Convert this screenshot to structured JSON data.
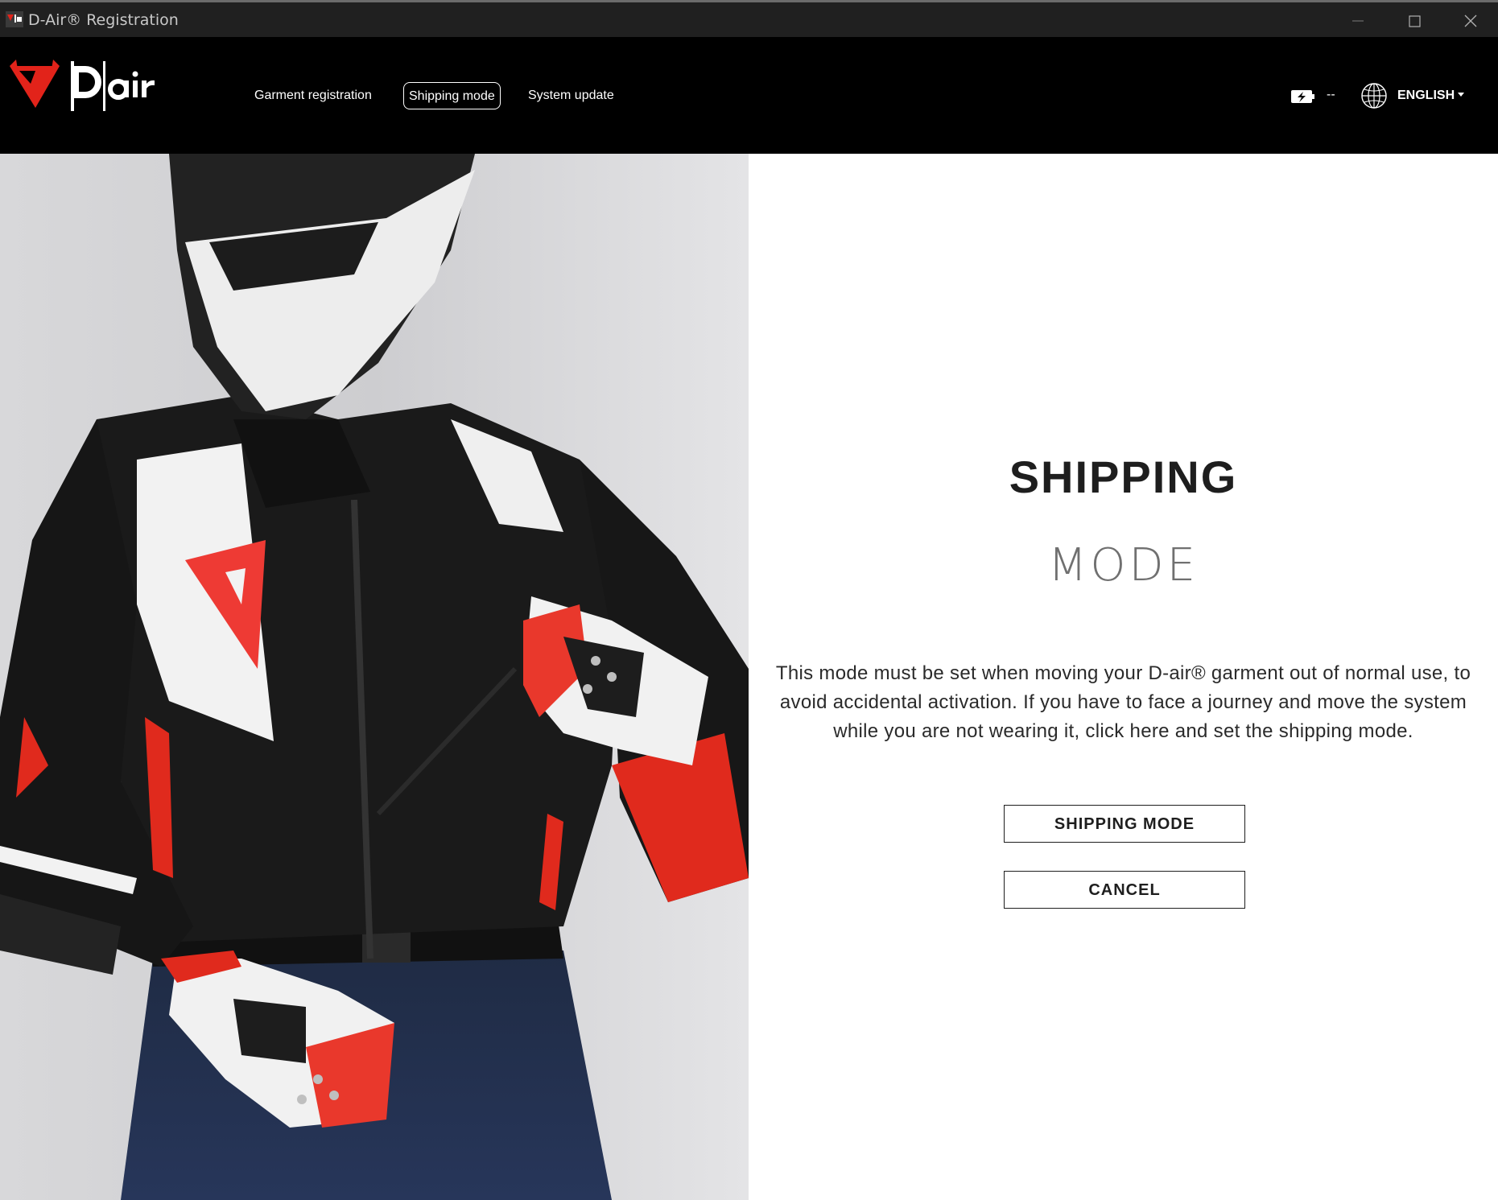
{
  "window": {
    "title": "D-Air® Registration"
  },
  "header": {
    "logo_text": "Dair",
    "nav": [
      {
        "label": "Garment registration",
        "active": false
      },
      {
        "label": "Shipping mode",
        "active": true
      },
      {
        "label": "System update",
        "active": false
      }
    ],
    "battery_status": "--",
    "language": "ENGLISH"
  },
  "content": {
    "heading_primary": "SHIPPING",
    "heading_secondary": "MODE",
    "description": "This mode must be set when moving your D-air® garment out of normal use, to avoid accidental activation. If you have to face a journey and move the system while you are not wearing it, click here and set the shipping mode.",
    "primary_button": "SHIPPING MODE",
    "secondary_button": "CANCEL"
  },
  "icons": {
    "app": "dainese-app-icon",
    "minimize": "minimize-icon",
    "maximize": "maximize-icon",
    "close": "close-icon",
    "battery": "battery-charging-icon",
    "globe": "globe-icon",
    "logo": "dainese-devil-logo"
  },
  "colors": {
    "brand_red": "#e2231a",
    "header_bg": "#000000",
    "titlebar_bg": "#202020",
    "text_dark": "#1e1e1e"
  }
}
